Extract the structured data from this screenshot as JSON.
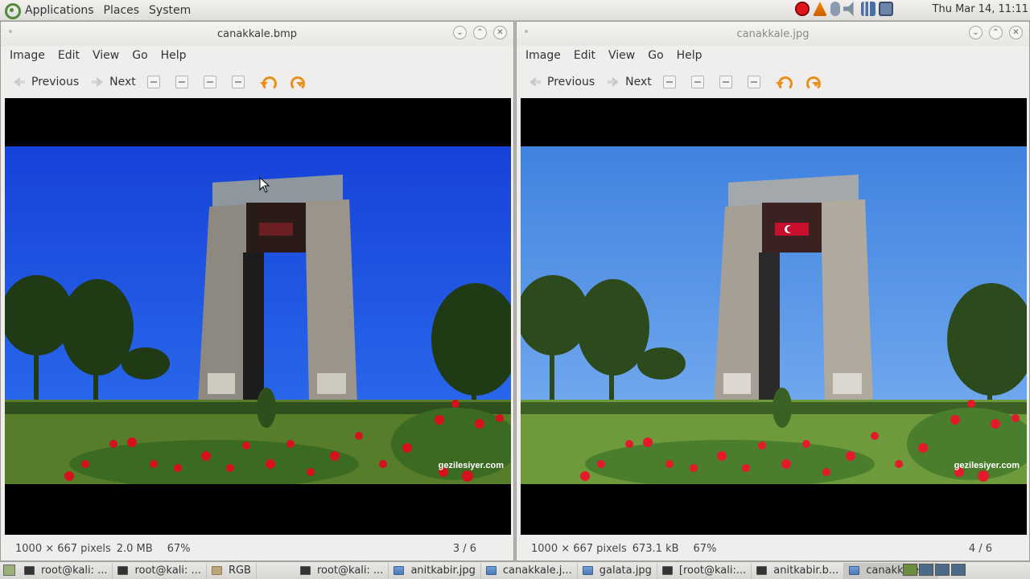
{
  "top_panel": {
    "menus": [
      "Applications",
      "Places",
      "System"
    ],
    "clock": "Thu Mar 14, 11:11",
    "tray_icons": [
      "record-icon",
      "vlc-icon",
      "microphone-icon",
      "volume-icon",
      "network-icon",
      "printer-icon"
    ]
  },
  "windows": [
    {
      "title": "canakkale.bmp",
      "menus": [
        "Image",
        "Edit",
        "View",
        "Go",
        "Help"
      ],
      "toolbar": {
        "previous": "Previous",
        "next": "Next"
      },
      "status": {
        "dims": "1000 × 667 pixels",
        "size": "2.0 MB",
        "zoom": "67%",
        "position": "3 / 6"
      },
      "watermark": "gezilesiyer.com"
    },
    {
      "title": "canakkale.jpg",
      "menus": [
        "Image",
        "Edit",
        "View",
        "Go",
        "Help"
      ],
      "toolbar": {
        "previous": "Previous",
        "next": "Next"
      },
      "status": {
        "dims": "1000 × 667 pixels",
        "size": "673.1 kB",
        "zoom": "67%",
        "position": "4 / 6"
      },
      "watermark": "gezilesiyer.com"
    }
  ],
  "taskbar": {
    "tasks": [
      {
        "label": "root@kali: ...",
        "icon": "terminal-icon"
      },
      {
        "label": "root@kali: ...",
        "icon": "terminal-icon"
      },
      {
        "label": "RGB",
        "icon": "folder-icon"
      },
      {
        "label": "root@kali: ...",
        "icon": "terminal-icon"
      },
      {
        "label": "anitkabir.jpg",
        "icon": "image-icon"
      },
      {
        "label": "canakkale.j...",
        "icon": "image-icon"
      },
      {
        "label": "galata.jpg",
        "icon": "image-icon"
      },
      {
        "label": "[root@kali:...",
        "icon": "terminal-icon"
      },
      {
        "label": "anitkabir.b...",
        "icon": "terminal-icon"
      },
      {
        "label": "canakkale....",
        "icon": "image-icon"
      }
    ]
  },
  "colors": {
    "sky_left": "#1a4fe0",
    "sky_right": "#4a8ee6",
    "grass": "#6e9a3c",
    "flag_red": "#c8102e"
  }
}
